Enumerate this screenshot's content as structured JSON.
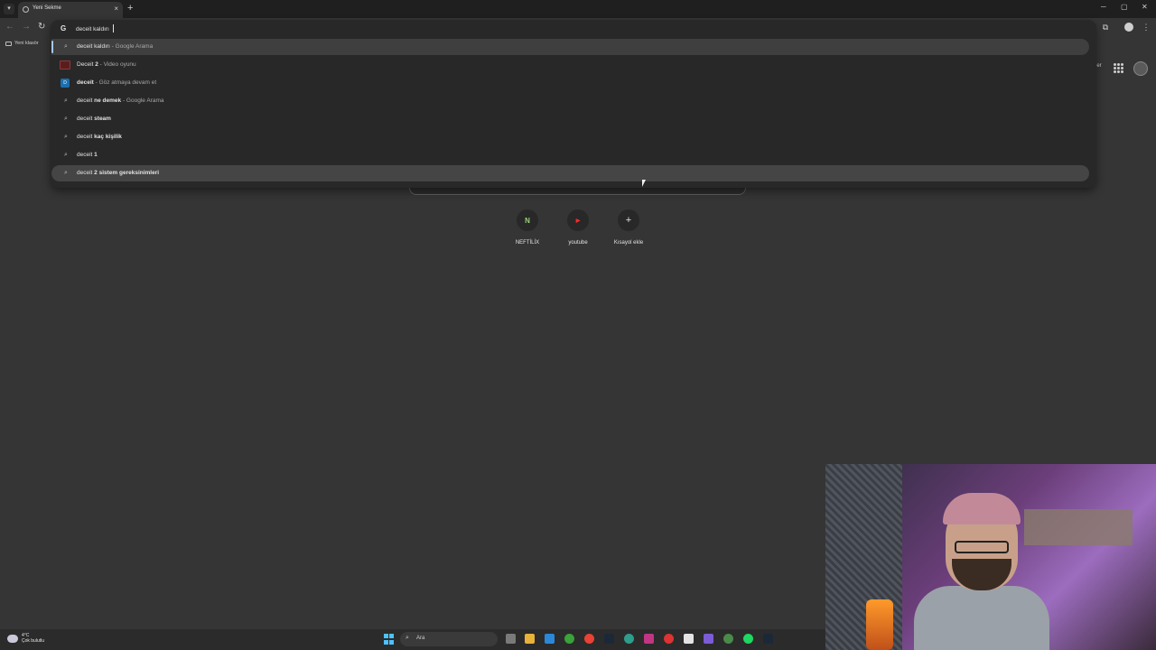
{
  "browser": {
    "tab_title": "Yeni Sekme",
    "new_tab_symbol": "+",
    "close_symbol": "×",
    "window_controls": [
      "─",
      "▢",
      "✕"
    ]
  },
  "toolbar": {
    "back": "←",
    "forward": "→",
    "reload": "↻",
    "extensions_symbol": "⧉",
    "more_symbol": "⋮"
  },
  "bookmarks": {
    "folder_label": "Yeni klasör"
  },
  "omnibox": {
    "engine_letter": "G",
    "value": "deceit kaldırı",
    "suggestions": [
      {
        "type": "search",
        "prefix": "deceit kaldırı",
        "bold": "",
        "desc": " - Google Arama"
      },
      {
        "type": "entity",
        "prefix": "Deceit",
        "bold": " 2",
        "desc": " - Video oyunu"
      },
      {
        "type": "site",
        "prefix": "",
        "bold": "deceit",
        "desc": " - Göz atmaya devam et"
      },
      {
        "type": "search",
        "prefix": "deceit",
        "bold": " ne demek",
        "desc": " - Google Arama"
      },
      {
        "type": "search",
        "prefix": "deceit",
        "bold": " steam",
        "desc": ""
      },
      {
        "type": "search",
        "prefix": "deceit",
        "bold": " kaç kişilik",
        "desc": ""
      },
      {
        "type": "search",
        "prefix": "deceit",
        "bold": " 1",
        "desc": ""
      },
      {
        "type": "search",
        "prefix": "deceit",
        "bold": " 2 sistem gereksinimleri",
        "desc": ""
      }
    ]
  },
  "ntp": {
    "right_label": "ler",
    "shortcuts": [
      {
        "label": "NEFTİLİX",
        "letter": "N",
        "color": "#9bcf7a"
      },
      {
        "label": "youtube",
        "letter": "▶",
        "color": "#ff2a2a"
      },
      {
        "label": "Kısayol ekle",
        "letter": "+",
        "color": "#e3e3e3"
      }
    ]
  },
  "taskbar": {
    "temperature": "4°C",
    "weather": "Çok bulutlu",
    "search_label": "Ara",
    "search_symbol": "⌕"
  }
}
